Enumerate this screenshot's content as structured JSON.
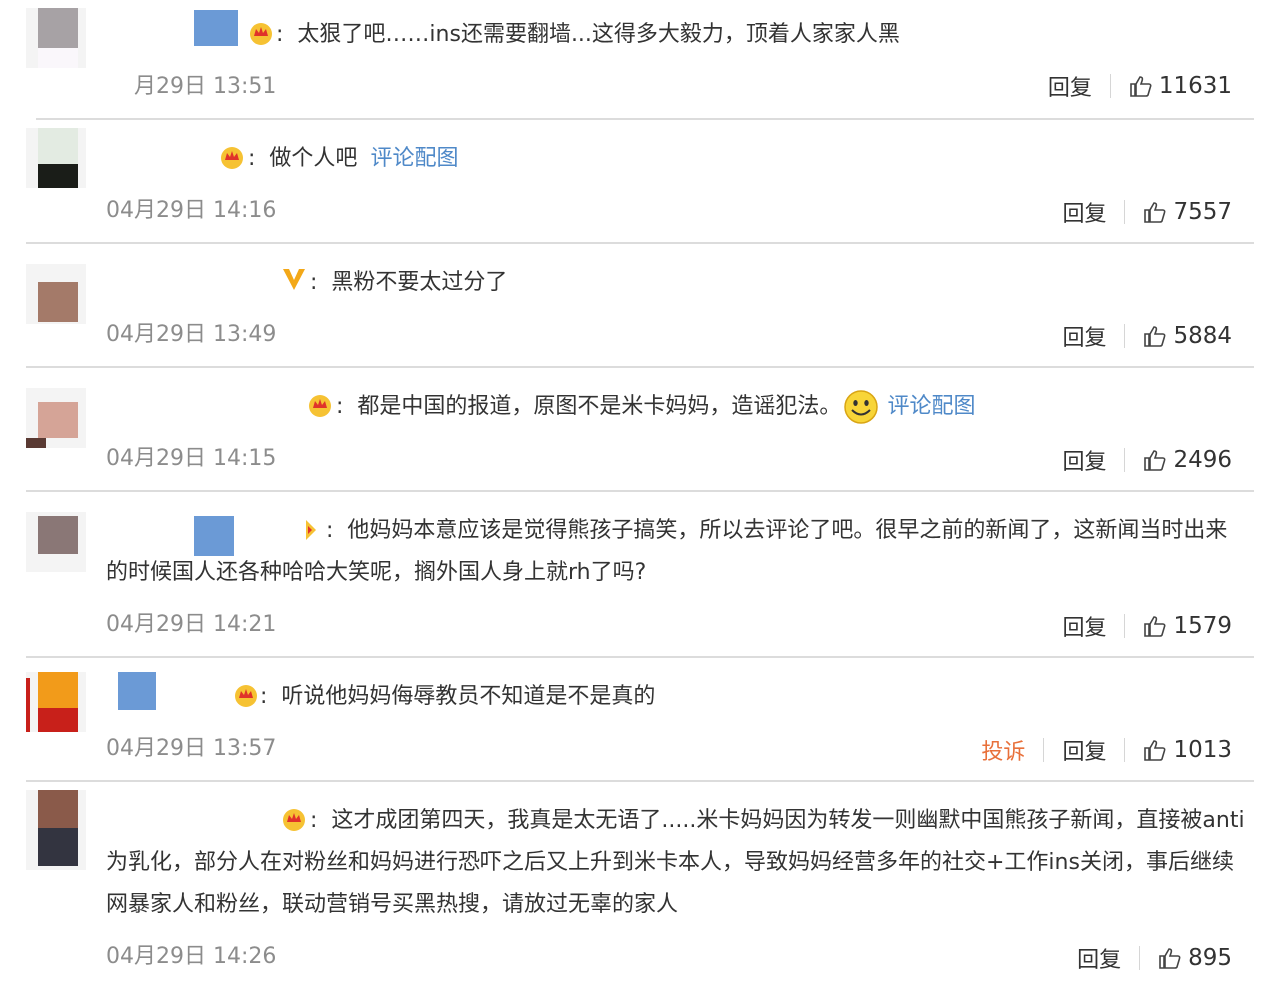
{
  "comments": [
    {
      "text": "太狠了吧……ins还需要翻墙...这得多大毅力，顶着人家家人黑",
      "time": "月29日 13:51",
      "actions": [
        "回复"
      ],
      "likes": "11631"
    },
    {
      "text": "做个人吧",
      "link": "评论配图",
      "time": "04月29日 14:16",
      "actions": [
        "回复"
      ],
      "likes": "7557"
    },
    {
      "text": "黑粉不要太过分了",
      "time": "04月29日 13:49",
      "actions": [
        "回复"
      ],
      "likes": "5884"
    },
    {
      "text": "都是中国的报道，原图不是米卡妈妈，造谣犯法。",
      "link": "评论配图",
      "time": "04月29日 14:15",
      "actions": [
        "回复"
      ],
      "likes": "2496"
    },
    {
      "text": "他妈妈本意应该是觉得熊孩子搞笑，所以去评论了吧。很早之前的新闻了，这新闻当时出来的时候国人还各种哈哈大笑呢，搁外国人身上就rh了吗?",
      "time": "04月29日 14:21",
      "actions": [
        "回复"
      ],
      "likes": "1579"
    },
    {
      "text": "听说他妈妈侮辱教员不知道是不是真的",
      "time": "04月29日 13:57",
      "actions": [
        "投诉",
        "回复"
      ],
      "likes": "1013"
    },
    {
      "text": "这才成团第四天，我真是太无语了.....米卡妈妈因为转发一则幽默中国熊孩子新闻，直接被anti为乳化，部分人在对粉丝和妈妈进行恐吓之后又上升到米卡本人，导致妈妈经营多年的社交+工作ins关闭，事后继续网暴家人和粉丝，联动营销号买黑热搜，请放过无辜的家人",
      "time": "04月29日 14:26",
      "actions": [
        "回复"
      ],
      "likes": "895"
    }
  ],
  "colors": {
    "link": "#4f89c8",
    "report": "#e8703a",
    "timestamp": "#8c8c8c",
    "divider": "#dcdcdc"
  },
  "icons": [
    "crown-badge-icon",
    "v-badge-icon",
    "smiley-emoji-icon",
    "thumbs-up-icon"
  ]
}
